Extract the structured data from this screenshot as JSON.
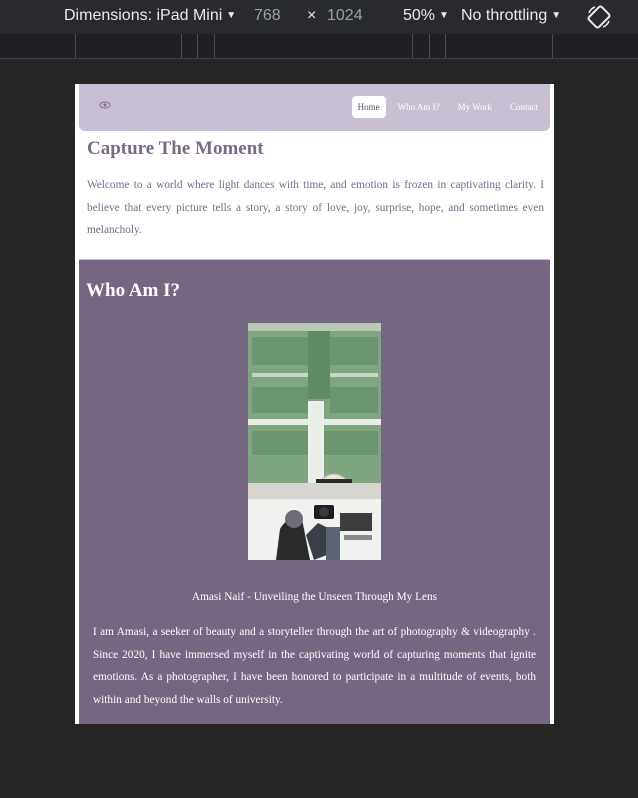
{
  "devtools": {
    "dimensions_label": "Dimensions: iPad Mini",
    "width": "768",
    "times": "×",
    "height": "1024",
    "zoom": "50%",
    "throttling": "No throttling"
  },
  "site": {
    "nav": {
      "logo_icon": "eye-icon",
      "links": [
        "Home",
        "Who Am I?",
        "My Work",
        "Contact"
      ],
      "active": "Home"
    },
    "intro": {
      "title": "Capture The Moment",
      "text": "Welcome to a world where light dances with time, and emotion is frozen in captivating clarity. I believe that every picture tells a story, a story of love, joy, surprise, hope, and sometimes even melancholy."
    },
    "about": {
      "title": "Who Am I?",
      "caption": "Amasi Naif - Unveiling the Unseen Through My Lens",
      "bio": "I am Amasi, a seeker of beauty and a storyteller through the art of photography & videography . Since 2020, I have immersed myself in the captivating world of capturing moments that ignite emotions. As a photographer, I have been honored to participate in a multitude of events, both within and beyond the walls of university."
    }
  },
  "colors": {
    "nav_bg": "#c9bfd3",
    "accent": "#7a6a88",
    "section_bg": "#756682"
  }
}
